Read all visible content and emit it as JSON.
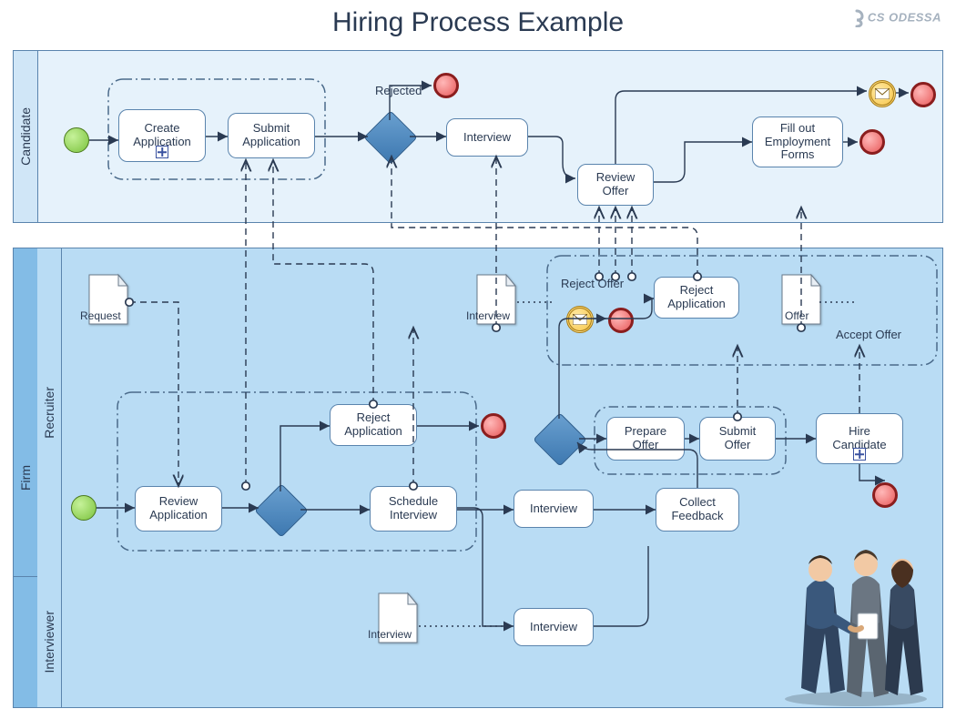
{
  "title": "Hiring Process Example",
  "brand": "CS ODESSA",
  "pools": {
    "candidate": {
      "label": "Candidate"
    },
    "firm": {
      "label": "Firm",
      "lanes": {
        "recruiter": "Recruiter",
        "interviewer": "Interviewer"
      }
    }
  },
  "tasks": {
    "create_app": "Create Application",
    "submit_app": "Submit Application",
    "interview_cand": "Interview",
    "review_offer": "Review Offer",
    "fill_forms": "Fill out Employment Forms",
    "reject_app_top": "Reject Application",
    "reject_app_rec": "Reject Application",
    "prepare_offer": "Prepare Offer",
    "submit_offer": "Submit Offer",
    "hire_candidate": "Hire Candidate",
    "review_app": "Review Application",
    "schedule_int": "Schedule Interview",
    "interview_rec": "Interview",
    "collect_fb": "Collect Feedback",
    "interview_ivr": "Interview"
  },
  "labels": {
    "rejected": "Rejected",
    "reject_offer": "Reject Offer",
    "accept_offer": "Accept Offer"
  },
  "docs": {
    "request": "Request",
    "interview1": "Interview",
    "interview2": "Interview",
    "offer": "Offer"
  },
  "icons": {
    "start": "start-event",
    "end": "end-event",
    "message": "message-event",
    "gateway": "exclusive-gateway",
    "document": "data-object"
  }
}
